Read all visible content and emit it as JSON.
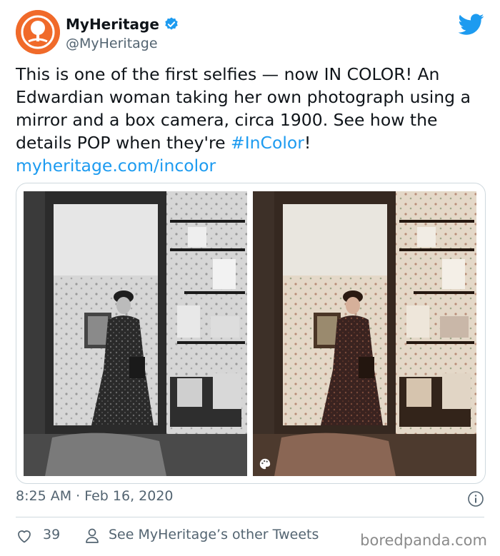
{
  "tweet": {
    "author_name": "MyHeritage",
    "author_handle": "@MyHeritage",
    "text_main": "This is one of the first selfies — now IN COLOR! An Edwardian woman taking her own photograph using a mirror and a box camera, circa 1900. See how the details POP when they're ",
    "hashtag": "#InColor",
    "text_after_hashtag": "!",
    "link": "myheritage.com/incolor",
    "timestamp": "8:25 AM · Feb 16, 2020",
    "likes": "39",
    "other_tweets_label": "See MyHeritage’s other Tweets"
  },
  "icons": {
    "avatar": "myheritage-logo",
    "verified": "verified-badge-icon",
    "bird": "twitter-bird-icon",
    "info": "info-icon",
    "heart": "heart-icon",
    "person": "person-icon",
    "palette": "palette-icon"
  },
  "colors": {
    "brand_orange": "#f06a2a",
    "twitter_blue": "#1d9bf0",
    "secondary_text": "#536471",
    "border": "#cfd9de"
  },
  "watermark": "boredpanda.com"
}
